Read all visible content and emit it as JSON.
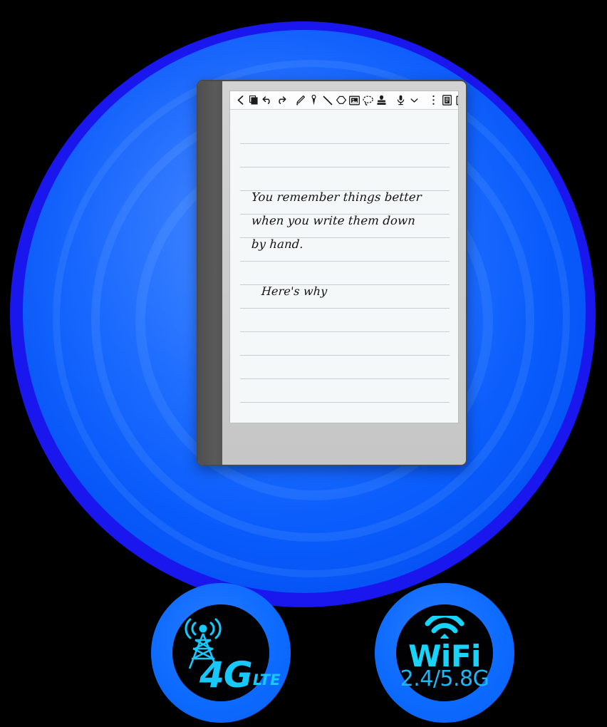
{
  "scene": {
    "background_color": "#000000",
    "disc_color": "#0a5cfc",
    "halo_color": "#1a16ee",
    "accent_cyan": "#17d4fb"
  },
  "device": {
    "name": "e-ink-note-tablet",
    "bezel_color": "#4a4a4a",
    "body_color": "#c8c8c8",
    "screen_color": "#f4f8f9"
  },
  "toolbar": {
    "groups": [
      {
        "name": "navigation",
        "items": [
          {
            "icon": "back-chevron-icon",
            "label": "Back"
          },
          {
            "icon": "layers-icon",
            "label": "Layers"
          },
          {
            "icon": "undo-icon",
            "label": "Undo"
          },
          {
            "icon": "redo-icon",
            "label": "Redo"
          }
        ]
      },
      {
        "name": "tools",
        "items": [
          {
            "icon": "pen-icon",
            "label": "Pen"
          },
          {
            "icon": "brush-icon",
            "label": "Brush"
          },
          {
            "icon": "line-icon",
            "label": "Line"
          },
          {
            "icon": "eraser-icon",
            "label": "Eraser"
          },
          {
            "icon": "image-insert-icon",
            "label": "Insert image"
          },
          {
            "icon": "lasso-select-icon",
            "label": "Lasso select"
          },
          {
            "icon": "stamp-icon",
            "label": "Stamp"
          }
        ]
      },
      {
        "name": "recording",
        "items": [
          {
            "icon": "microphone-icon",
            "label": "Record audio"
          },
          {
            "icon": "chevron-down-icon",
            "label": "More recording options"
          }
        ]
      },
      {
        "name": "document",
        "items": [
          {
            "icon": "more-vertical-icon",
            "label": "More"
          },
          {
            "icon": "page-icon",
            "label": "Page settings"
          },
          {
            "icon": "share-export-icon",
            "label": "Export"
          }
        ]
      }
    ]
  },
  "note": {
    "ruled_line_count": 12,
    "line_spacing_px": 33,
    "blocks": [
      {
        "id": "block-1",
        "lines": [
          "You remember things better",
          "when you write them down",
          "by hand."
        ]
      },
      {
        "id": "block-2",
        "lines": [
          "Here's why"
        ]
      }
    ]
  },
  "badges": [
    {
      "id": "lte",
      "name": "4g-lte-badge",
      "icon": "cell-tower-icon",
      "primary_text": "4G",
      "secondary_text": "LTE",
      "circle_color": "#0d6bff",
      "core_color": "#010103",
      "glyph_color": "#17c9fb"
    },
    {
      "id": "wifi",
      "name": "wifi-badge",
      "icon": "wifi-icon",
      "primary_text": "WiFi",
      "secondary_text": "2.4/5.8G",
      "circle_color": "#0d6bff",
      "core_color": "#010103",
      "glyph_color": "#17d4fb"
    }
  ]
}
